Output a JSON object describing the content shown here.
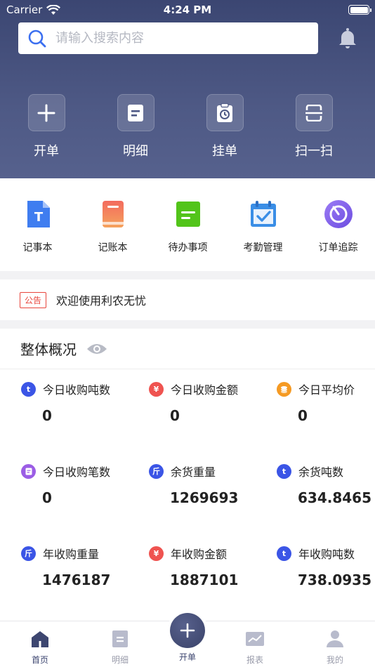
{
  "status": {
    "carrier": "Carrier",
    "time": "4:24 PM"
  },
  "search": {
    "placeholder": "请输入搜索内容"
  },
  "quick_actions": [
    {
      "label": "开单",
      "icon": "plus-icon"
    },
    {
      "label": "明细",
      "icon": "document-icon"
    },
    {
      "label": "挂单",
      "icon": "clipboard-clock-icon"
    },
    {
      "label": "扫一扫",
      "icon": "scan-icon"
    }
  ],
  "tools": [
    {
      "label": "记事本",
      "icon": "notepad-icon",
      "color": "#3f7df0"
    },
    {
      "label": "记账本",
      "icon": "ledger-icon",
      "color": "#f0655a"
    },
    {
      "label": "待办事项",
      "icon": "todo-icon",
      "color": "#52c41a"
    },
    {
      "label": "考勤管理",
      "icon": "calendar-check-icon",
      "color": "#3a8ee6"
    },
    {
      "label": "订单追踪",
      "icon": "tracking-icon",
      "color": "#8a63f0"
    }
  ],
  "notice": {
    "tag": "公告",
    "text": "欢迎使用利农无忧"
  },
  "overview": {
    "title": "整体概况",
    "stats": [
      {
        "name": "今日收购吨数",
        "value": "0",
        "badge": "t",
        "color": "#3b55e6"
      },
      {
        "name": "今日收购金额",
        "value": "0",
        "badge": "¥",
        "color": "#ef5350"
      },
      {
        "name": "今日平均价",
        "value": "0",
        "badge": "coins",
        "color": "#f59a23"
      },
      {
        "name": "今日收购笔数",
        "value": "0",
        "badge": "doc",
        "color": "#9b5de5"
      },
      {
        "name": "余货重量",
        "value": "1269693",
        "badge": "斤",
        "color": "#3b55e6"
      },
      {
        "name": "余货吨数",
        "value": "634.8465",
        "badge": "t",
        "color": "#3b55e6"
      },
      {
        "name": "年收购重量",
        "value": "1476187",
        "badge": "斤",
        "color": "#3b55e6"
      },
      {
        "name": "年收购金额",
        "value": "1887101",
        "badge": "¥",
        "color": "#ef5350"
      },
      {
        "name": "年收购吨数",
        "value": "738.0935",
        "badge": "t",
        "color": "#3b55e6"
      }
    ]
  },
  "tabbar": {
    "items": [
      {
        "label": "首页",
        "icon": "home-icon",
        "active": true
      },
      {
        "label": "明细",
        "icon": "document-icon",
        "active": false
      },
      {
        "label": "开单",
        "icon": "plus-icon",
        "active": false
      },
      {
        "label": "报表",
        "icon": "chart-icon",
        "active": false
      },
      {
        "label": "我的",
        "icon": "user-icon",
        "active": false
      }
    ]
  }
}
